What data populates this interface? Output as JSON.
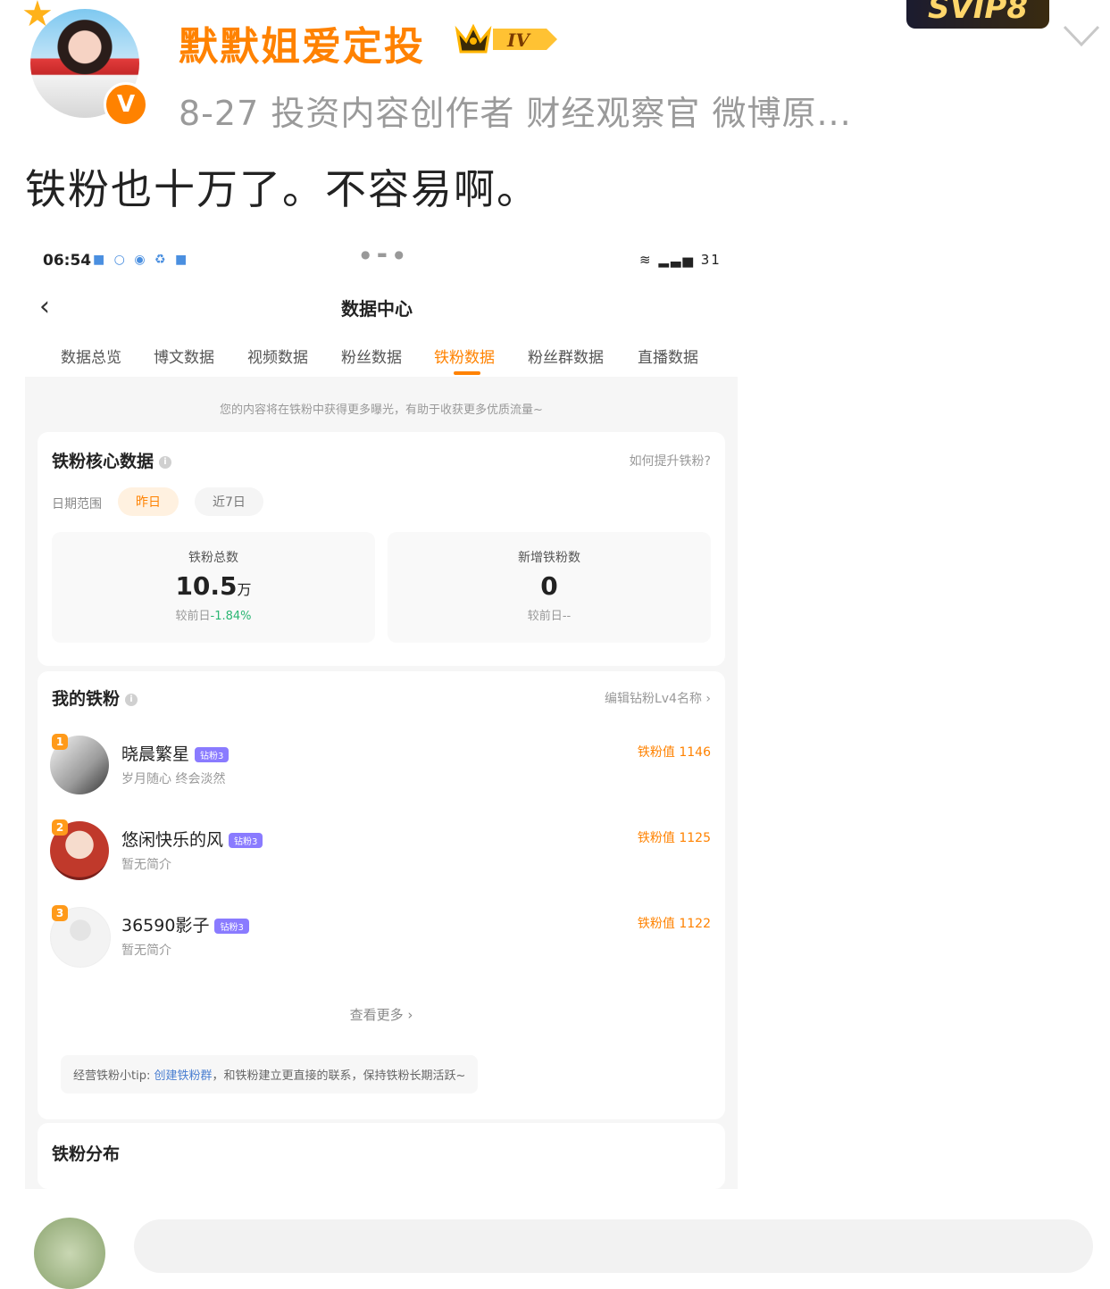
{
  "post": {
    "username": "默默姐爱定投",
    "level_badge": "IV",
    "verified_badge": "V",
    "svip_badge": "SVIP8",
    "meta": "8-27  投资内容创作者 财经观察官 微博原...",
    "text": "铁粉也十万了。不容易啊。"
  },
  "screenshot": {
    "status_bar": {
      "time": "06:54",
      "right": "31"
    },
    "nav": {
      "back": "‹",
      "title": "数据中心"
    },
    "tabs": [
      {
        "label": "数据总览",
        "active": false
      },
      {
        "label": "博文数据",
        "active": false
      },
      {
        "label": "视频数据",
        "active": false
      },
      {
        "label": "粉丝数据",
        "active": false
      },
      {
        "label": "铁粉数据",
        "active": true
      },
      {
        "label": "粉丝群数据",
        "active": false
      },
      {
        "label": "直播数据",
        "active": false
      }
    ],
    "tip_bar": "您的内容将在铁粉中获得更多曝光，有助于收获更多优质流量~",
    "core": {
      "title": "铁粉核心数据",
      "link": "如何提升铁粉?",
      "range_label": "日期范围",
      "range_options": [
        "昨日",
        "近7日"
      ],
      "stats": [
        {
          "label": "铁粉总数",
          "value": "10.5",
          "unit": "万",
          "compare_prefix": "较前日",
          "compare_value": "-1.84%"
        },
        {
          "label": "新增铁粉数",
          "value": "0",
          "unit": "",
          "compare_prefix": "较前日",
          "compare_value": "--"
        }
      ]
    },
    "my_fans": {
      "title": "我的铁粉",
      "link": "编辑钻粉Lv4名称 ›",
      "fans": [
        {
          "rank": "1",
          "name": "晓晨繁星",
          "badge": "钻粉3",
          "bio": "岁月随心 终会淡然",
          "value": "铁粉值 1146"
        },
        {
          "rank": "2",
          "name": "悠闲快乐的风",
          "badge": "钻粉3",
          "bio": "暂无简介",
          "value": "铁粉值 1125"
        },
        {
          "rank": "3",
          "name": "36590影子",
          "badge": "钻粉3",
          "bio": "暂无简介",
          "value": "铁粉值 1122"
        }
      ],
      "more": "查看更多 ›",
      "tip_prefix": "经营铁粉小tip:",
      "tip_link": "创建铁粉群",
      "tip_suffix": "，和铁粉建立更直接的联系，保持铁粉长期活跃~"
    },
    "distribution": {
      "title": "铁粉分布"
    }
  }
}
